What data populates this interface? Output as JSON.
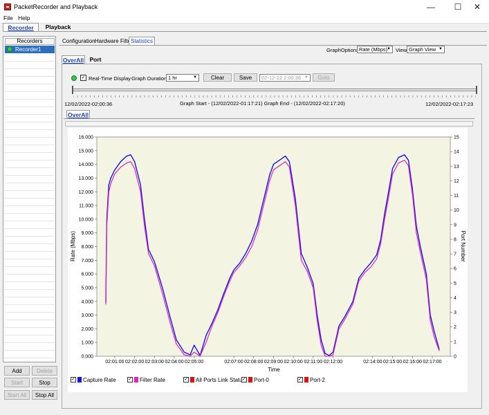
{
  "window": {
    "title": "PacketRecorder and Playback",
    "minimize_glyph": "—",
    "maximize_glyph": "☐",
    "close_glyph": "✕"
  },
  "menu": [
    "File",
    "Help"
  ],
  "main_tabs": [
    {
      "label": "Recorder",
      "active": true
    },
    {
      "label": "Playback",
      "active": false
    }
  ],
  "recorders": {
    "header": "Recorders",
    "items": [
      {
        "label": "Recorder1",
        "selected": true
      }
    ]
  },
  "left_buttons": [
    {
      "label": "Add",
      "enabled": true
    },
    {
      "label": "Delete",
      "enabled": false
    },
    {
      "label": "Start",
      "enabled": false
    },
    {
      "label": "Stop",
      "enabled": true
    },
    {
      "label": "Start All",
      "enabled": false
    },
    {
      "label": "Stop All",
      "enabled": true
    }
  ],
  "sub_tabs": [
    {
      "label": "Configuration",
      "active": false
    },
    {
      "label": "Hardware Filter",
      "active": false
    },
    {
      "label": "Statistics",
      "active": true
    }
  ],
  "graph_options": {
    "label": "GraphOptions",
    "value": "Rate (Mbps)",
    "view_label": "View",
    "view_value": "Graph View"
  },
  "stat_tabs": [
    {
      "label": "OverAll",
      "active": true
    },
    {
      "label": "Port",
      "active": false
    }
  ],
  "controls": {
    "realtime_label": "Real-Time Display",
    "realtime_checked": true,
    "duration_label": "Graph Duration",
    "duration_value": "1 hr",
    "clear_label": "Clear",
    "save_label": "Save",
    "datetime_value": "02-12-22  2:00:36",
    "goto_label": "Goto"
  },
  "timeline": {
    "left_time": "12/02/2022-02:00:36",
    "right_time": "12/02/2022-02:17:23",
    "range_text": "Graph Start - (12/02/2022-01:17:21) Graph End - (12/02/2022-02:17:20)"
  },
  "inner_tab": "OverAll",
  "legend": [
    {
      "label": "Capture Rate",
      "color": "#1414e0"
    },
    {
      "label": "Filter Rate",
      "color": "#e020c0"
    },
    {
      "label": "All Ports Link Status",
      "color": "#e01010"
    },
    {
      "label": "Port-0",
      "color": "#e01010"
    },
    {
      "label": "Port-2",
      "color": "#e01010"
    }
  ],
  "chart_data": {
    "type": "line",
    "xlabel": "Time",
    "ylabel": "Rate (Mbps)",
    "y2label": "Port Number",
    "ylim": [
      0,
      16
    ],
    "y2lim": [
      0,
      15
    ],
    "yticks": [
      "0.000",
      "1.000",
      "2.000",
      "3.000",
      "4.000",
      "5.000",
      "6.000",
      "7.000",
      "8.000",
      "9.000",
      "10.000",
      "11.000",
      "12.000",
      "13.000",
      "14.000",
      "15.000",
      "16.000"
    ],
    "y2ticks": [
      "0",
      "1",
      "2",
      "3",
      "4",
      "5",
      "6",
      "7",
      "8",
      "9",
      "10",
      "11",
      "12",
      "13",
      "14",
      "15"
    ],
    "xlim": [
      0,
      16.6
    ],
    "x_tick_positions": [
      0,
      1,
      2,
      3,
      4,
      6,
      7,
      8,
      9,
      10,
      11,
      13,
      14,
      15,
      16
    ],
    "x_tick_labels": [
      "02:01:00",
      "02:02:00",
      "02:03:00",
      "02:04:00",
      "02:05:00",
      "02:07:00",
      "02:08:00",
      "02:09:00",
      "02:10:00",
      "02:11:00",
      "02:12:00",
      "02:14:00",
      "02:15:00",
      "02:16:00",
      "02:17:00"
    ],
    "series": [
      {
        "name": "Capture Rate",
        "color": "#1414e0",
        "x": [
          -0.45,
          -0.4,
          -0.3,
          -0.2,
          0,
          0.3,
          0.6,
          0.8,
          1.0,
          1.3,
          1.5,
          1.7,
          2.0,
          2.4,
          2.8,
          3.1,
          3.5,
          3.8,
          4.0,
          4.3,
          4.6,
          4.9,
          5.2,
          5.5,
          5.8,
          6.0,
          6.3,
          6.6,
          6.9,
          7.2,
          7.4,
          7.6,
          7.8,
          8.0,
          8.3,
          8.6,
          8.8,
          9.1,
          9.4,
          9.7,
          10.0,
          10.2,
          10.4,
          10.6,
          10.8,
          11.0,
          11.3,
          11.6,
          12.0,
          12.3,
          12.6,
          12.9,
          13.2,
          13.4,
          13.6,
          13.8,
          14.0,
          14.3,
          14.6,
          14.8,
          15.0,
          15.2,
          15.4,
          15.7,
          15.9,
          16.1,
          16.35
        ],
        "y": [
          3.9,
          10.0,
          12.5,
          13.0,
          13.6,
          14.2,
          14.6,
          14.7,
          14.2,
          12.5,
          10.0,
          7.8,
          6.9,
          5.0,
          2.8,
          1.2,
          0.3,
          0.1,
          0.8,
          0.05,
          1.5,
          2.4,
          3.4,
          4.6,
          5.7,
          6.3,
          6.8,
          7.5,
          8.4,
          9.6,
          10.8,
          12.0,
          13.2,
          14.0,
          14.3,
          14.6,
          14.2,
          11.5,
          7.5,
          6.5,
          5.3,
          3.0,
          1.2,
          0.2,
          0.05,
          0.3,
          2.2,
          2.9,
          4.0,
          5.7,
          6.3,
          6.8,
          7.4,
          8.5,
          10.4,
          12.0,
          13.7,
          14.5,
          14.7,
          14.3,
          12.2,
          9.5,
          8.0,
          6.0,
          3.0,
          1.8,
          0.5
        ]
      },
      {
        "name": "Filter Rate",
        "color": "#e020c0",
        "x": [
          -0.45,
          -0.4,
          -0.3,
          -0.2,
          0,
          0.3,
          0.6,
          0.8,
          1.0,
          1.3,
          1.5,
          1.7,
          2.0,
          2.4,
          2.8,
          3.1,
          3.5,
          3.8,
          4.0,
          4.3,
          4.6,
          4.9,
          5.2,
          5.5,
          5.8,
          6.0,
          6.3,
          6.6,
          6.9,
          7.2,
          7.4,
          7.6,
          7.8,
          8.0,
          8.3,
          8.6,
          8.8,
          9.1,
          9.4,
          9.7,
          10.0,
          10.2,
          10.4,
          10.6,
          10.8,
          11.0,
          11.3,
          11.6,
          12.0,
          12.3,
          12.6,
          12.9,
          13.2,
          13.4,
          13.6,
          13.8,
          14.0,
          14.3,
          14.6,
          14.8,
          15.0,
          15.2,
          15.4,
          15.7,
          15.9,
          16.1,
          16.35
        ],
        "y": [
          3.8,
          9.5,
          12.0,
          12.6,
          13.3,
          13.8,
          14.1,
          14.2,
          13.7,
          12.0,
          9.5,
          7.5,
          6.6,
          4.6,
          2.4,
          0.9,
          0.1,
          0.0,
          0.3,
          0.0,
          1.0,
          2.2,
          3.2,
          4.4,
          5.5,
          6.1,
          6.6,
          7.2,
          8.0,
          9.2,
          10.4,
          11.6,
          12.8,
          13.6,
          13.9,
          14.2,
          13.8,
          11.0,
          7.0,
          6.2,
          5.0,
          2.6,
          0.8,
          0.0,
          0.0,
          0.1,
          2.0,
          2.7,
          3.8,
          5.5,
          6.1,
          6.5,
          7.1,
          8.2,
          10.0,
          11.6,
          13.3,
          14.1,
          14.3,
          13.9,
          11.8,
          9.0,
          7.6,
          5.6,
          2.6,
          1.4,
          0.4
        ]
      }
    ]
  }
}
